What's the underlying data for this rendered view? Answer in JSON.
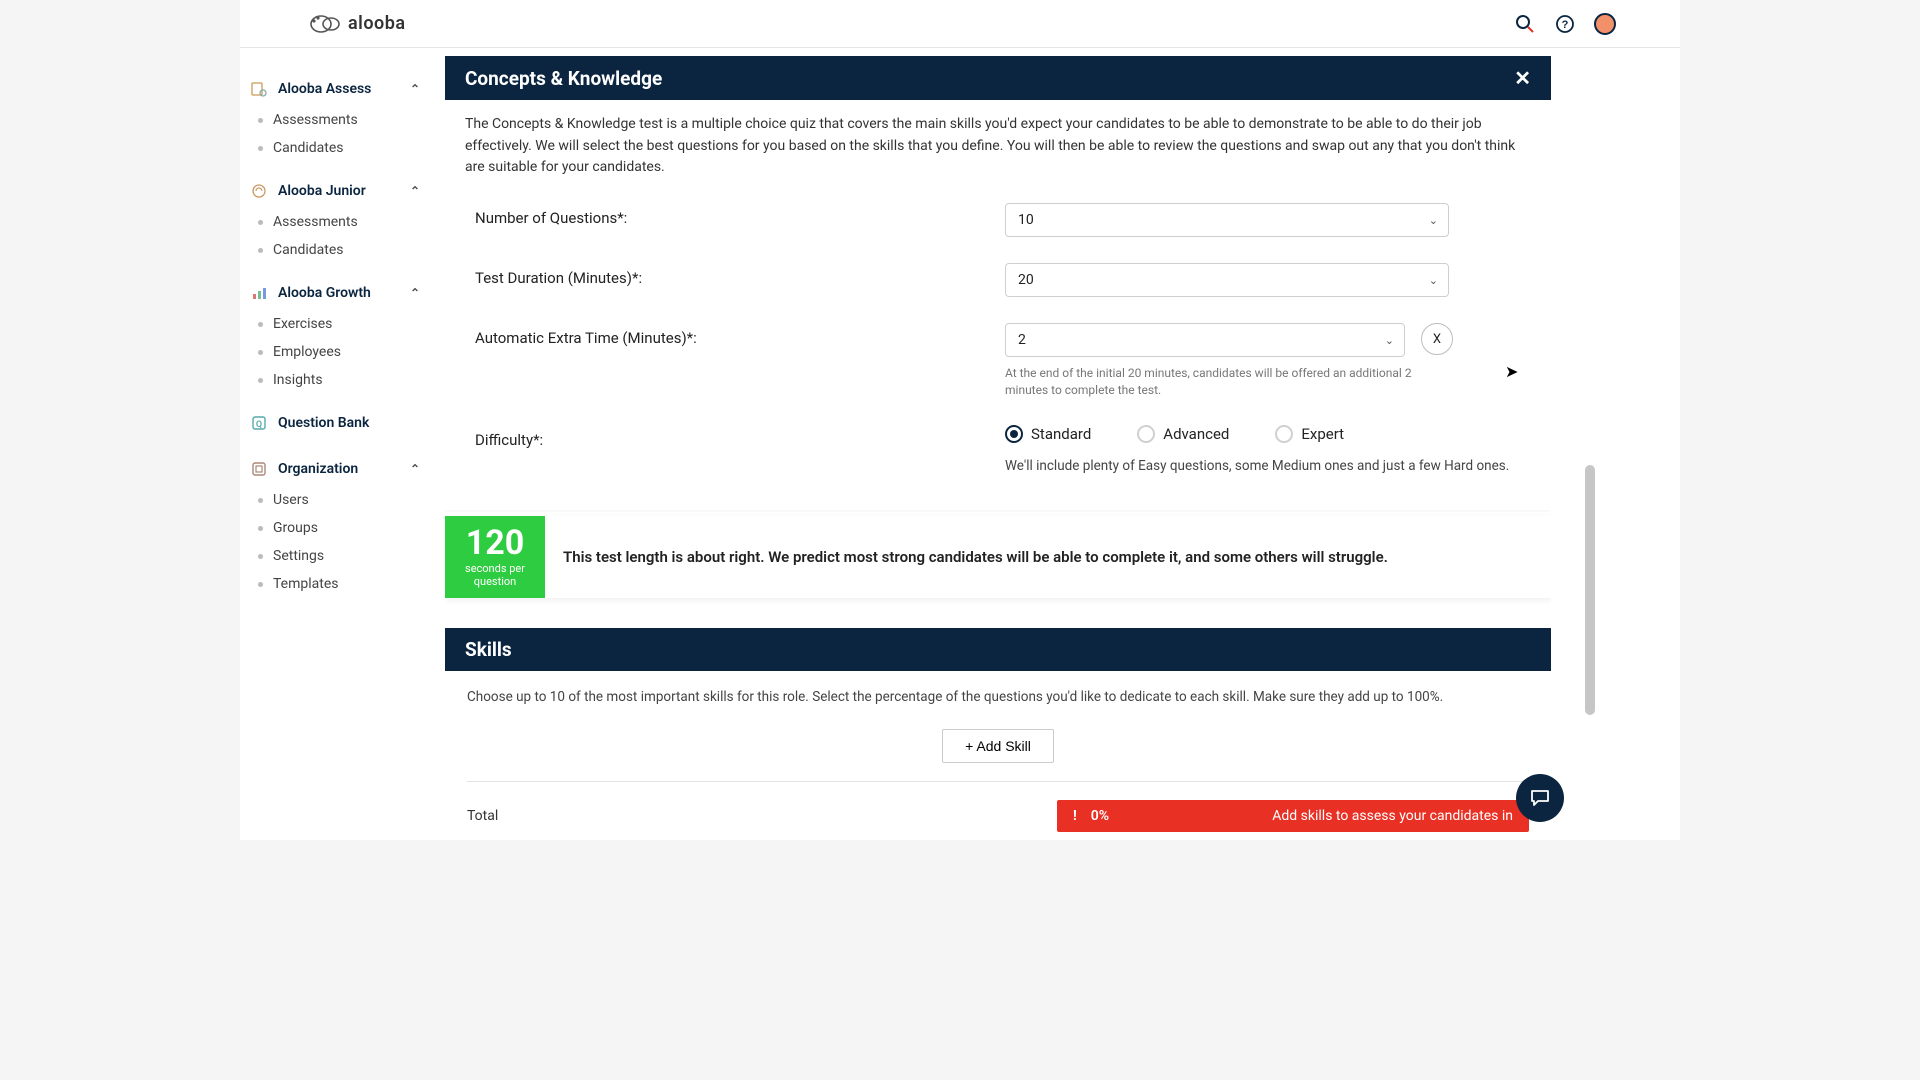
{
  "brand": {
    "name": "alooba"
  },
  "sidebar": {
    "groups": [
      {
        "label": "Alooba Assess",
        "items": [
          "Assessments",
          "Candidates"
        ]
      },
      {
        "label": "Alooba Junior",
        "items": [
          "Assessments",
          "Candidates"
        ]
      },
      {
        "label": "Alooba Growth",
        "items": [
          "Exercises",
          "Employees",
          "Insights"
        ]
      }
    ],
    "qbank": "Question Bank",
    "org": {
      "label": "Organization",
      "items": [
        "Users",
        "Groups",
        "Settings",
        "Templates"
      ]
    }
  },
  "panel": {
    "title": "Concepts & Knowledge",
    "desc": "The Concepts & Knowledge test is a multiple choice quiz that covers the main skills you'd expect your candidates to be able to demonstrate to be able to do their job effectively. We will select the best questions for you based on the skills that you define. You will then be able to review the questions and swap out any that you don't think are suitable for your candidates.",
    "numQuestions": {
      "label": "Number of Questions*:",
      "value": "10"
    },
    "duration": {
      "label": "Test Duration (Minutes)*:",
      "value": "20"
    },
    "extra": {
      "label": "Automatic Extra Time (Minutes)*:",
      "value": "2",
      "clear": "X",
      "helper": "At the end of the initial 20 minutes, candidates will be offered an additional 2 minutes to complete the test."
    },
    "difficulty": {
      "label": "Difficulty*:",
      "options": [
        "Standard",
        "Advanced",
        "Expert"
      ],
      "selected": 0,
      "helper": "We'll include plenty of Easy questions, some Medium ones and just a few Hard ones."
    }
  },
  "tpq": {
    "number": "120",
    "sub": "seconds per question",
    "text": "This test length is about right. We predict most strong candidates will be able to complete it, and some others will struggle."
  },
  "skills": {
    "title": "Skills",
    "desc": "Choose up to 10 of the most important skills for this role. Select the percentage of the questions you'd like to dedicate to each skill. Make sure they add up to 100%.",
    "addLabel": "+ Add Skill",
    "totalLabel": "Total",
    "pct": "0%",
    "warn": "Add skills to assess your candidates in"
  }
}
